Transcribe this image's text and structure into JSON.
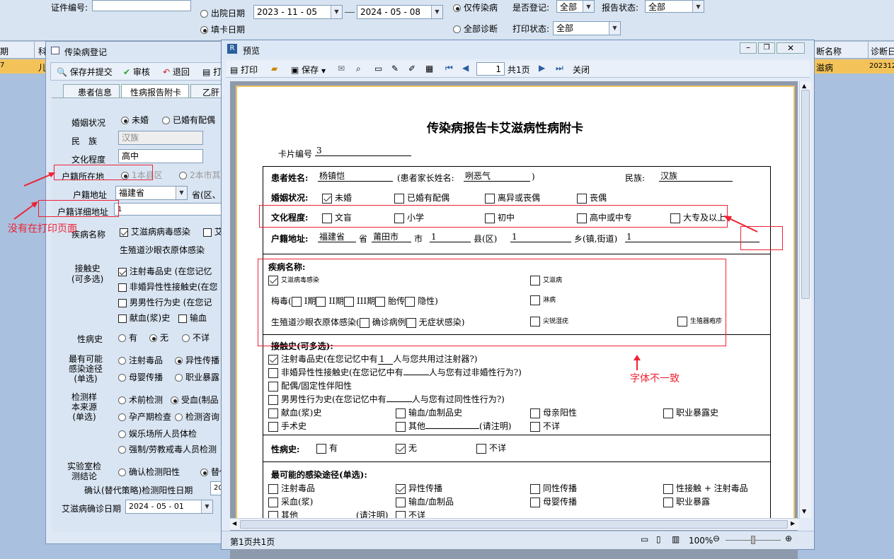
{
  "topbar": {
    "cert_label": "证件编号:",
    "discharge_date": "出院日期",
    "fill_date": "填卡日期",
    "date_from": "2023 - 11 - 05",
    "date_to": "2024 - 05 - 08",
    "only_infectious": "仅传染病",
    "all_diagnosis": "全部诊断",
    "registered_label": "是否登记:",
    "registered_value": "全部",
    "report_status_label": "报告状态:",
    "report_status_value": "全部",
    "print_status_label": "打印状态:",
    "print_status_value": "全部",
    "col_period": "期",
    "col_ke": "科",
    "col_disease_name": "断名称",
    "col_diag": "诊断日",
    "row_7": "7",
    "row_er": "儿",
    "row_disease": "滋病",
    "row_diag": "202312"
  },
  "reg": {
    "title": "传染病登记",
    "save": "保存并提交",
    "audit": "审核",
    "back": "退回",
    "print": "打",
    "tab1": "患者信息",
    "tab2": "性病报告附卡",
    "tab3": "乙肝",
    "marriage": "婚姻状况",
    "unmarried": "未婚",
    "married": "已婚有配偶",
    "ethnic": "民　族",
    "ethnic_val": "汉族",
    "education": "文化程度",
    "edu_val": "高中",
    "household": "户籍所在地",
    "hh1": "1本县区",
    "hh2": "2本市其它",
    "hh_addr": "户籍地址",
    "hh_addr_val": "福建省",
    "province": "省(区、",
    "hh_detail": "户籍详细地址",
    "hh_detail_val": "1",
    "disease": "疾病名称",
    "aids_infection": "艾滋病病毒感染",
    "aids_other": "艾",
    "chlamydia": "生殖道沙眼衣原体感染",
    "contact": "接触史\n(可多选)",
    "c1": "注射毒品史",
    "c1b": "(在您记忆",
    "c2": "非婚异性性接触史",
    "c2b": "(在您",
    "c3": "男男性行为史",
    "c3b": "(在您记",
    "c4": "献血(浆)史",
    "c4b": "输血",
    "std": "性病史",
    "yes": "有",
    "no": "无",
    "unknown": "不详",
    "route": "最有可能\n感染途径\n(单选)",
    "r1": "注射毒品",
    "r2": "异性传播",
    "r3": "母婴传播",
    "r4": "职业暴露",
    "source": "检测样\n本来源\n(单选)",
    "s1": "术前检测",
    "s2": "受血(制品",
    "s3": "孕产期检查",
    "s4": "检测咨询",
    "s5": "娱乐场所人员体检",
    "s6": "强制/劳教戒毒人员检测",
    "lab": "实验室检\n测结论",
    "lab1": "确认检测阳性",
    "lab2": "替代",
    "confirm_date_label": "确认(替代策略)检测阳性日期",
    "confirm_date_val": "20",
    "aids_date_label": "艾滋病确诊日期",
    "aids_date_val": "2024 - 05 - 01"
  },
  "preview": {
    "title": "预览",
    "print": "打印",
    "save": "保存",
    "page_total": "共1页",
    "page_num": "1",
    "close": "关闭",
    "status": "第1页共1页",
    "zoom": "100%"
  },
  "card": {
    "title": "传染病报告卡艾滋病性病附卡",
    "card_no_label": "卡片编号",
    "card_no": "3",
    "patient_label": "患者姓名:",
    "patient": "杨镇恺",
    "guardian_label": "(患者家长姓名:",
    "guardian": "咧恶气",
    "paren": ")",
    "ethnic_label": "民族:",
    "ethnic": "汉族",
    "marriage_label": "婚姻状况:",
    "m1": "未婚",
    "m2": "已婚有配偶",
    "m3": "离异或丧偶",
    "m4": "丧偶",
    "edu_label": "文化程度:",
    "e1": "文盲",
    "e2": "小学",
    "e3": "初中",
    "e4": "高中或中专",
    "e5": "大专及以上",
    "addr_label": "户籍地址:",
    "addr_prov": "福建省",
    "prov": "省",
    "addr_city": "莆田市",
    "city": "市",
    "addr_county": "1",
    "county": "县(区)",
    "addr_town": "1",
    "town": "乡(镇,街道)",
    "addr_detail": "1",
    "disease_label": "疾病名称:",
    "aids_inf": "艾滋病毒感染",
    "aids": "艾滋病",
    "syphilis": "梅毒(",
    "s1": "I期",
    "s2": "II期",
    "s3": "III期",
    "s4": "胎传",
    "s5": "隐性)",
    "gonorrhea": "淋病",
    "chlamydia": "生殖道沙眼衣原体感染(",
    "ch1": "确诊病例",
    "ch2": "无症状感染)",
    "condyloma": "尖锐湿疣",
    "herpes": "生殖器疱疹",
    "contact_label": "接触史(可多选):",
    "c1": "注射毒品史(在您记忆中有",
    "c1v": "1",
    "c1b": "人与您共用过注射器?)",
    "c2": "非婚异性性接触史(在您记忆中有",
    "c2b": "人与您有过非婚性行为?)",
    "c3": "配偶/固定性伴阳性",
    "c4": "男男性行为史(在您记忆中有",
    "c4b": "人与您有过同性性行为?)",
    "c5": "献血(浆)史",
    "c6": "输血/血制品史",
    "c7": "母亲阳性",
    "c8": "职业暴露史",
    "c9": "手术史",
    "c10": "其他",
    "c10b": "(请注明)",
    "c11": "不详",
    "std_label": "性病史:",
    "yes": "有",
    "no": "无",
    "unknown": "不详",
    "route_label": "最可能的感染途径(单选):",
    "r1": "注射毒品",
    "r2": "异性传播",
    "r3": "同性传播",
    "r4": "性接触 + 注射毒品",
    "r5": "采血(浆)",
    "r6": "输血/血制品",
    "r7": "母婴传播",
    "r8": "职业暴露",
    "r9": "其他",
    "r9b": "(请注明)",
    "r10": "不详"
  },
  "annotations": {
    "not_on_print": "没有在打印页面",
    "font_mismatch": "字体不一致"
  },
  "colors": {
    "annotation": "#e23",
    "accent": "#f0c060"
  }
}
